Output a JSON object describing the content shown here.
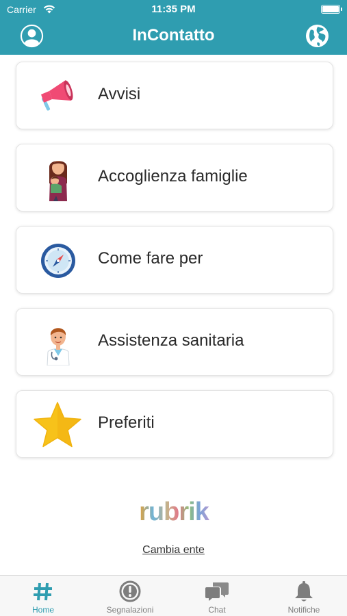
{
  "status_bar": {
    "carrier": "Carrier",
    "time": "11:35 PM"
  },
  "nav": {
    "title": "InContatto"
  },
  "menu": [
    {
      "label": "Avvisi",
      "icon": "megaphone-icon"
    },
    {
      "label": "Accoglienza famiglie",
      "icon": "mother-child-icon"
    },
    {
      "label": "Come fare per",
      "icon": "compass-icon"
    },
    {
      "label": "Assistenza sanitaria",
      "icon": "doctor-icon"
    },
    {
      "label": "Preferiti",
      "icon": "star-icon"
    }
  ],
  "footer": {
    "logo_text": "rubrik",
    "cambia_ente": "Cambia ente"
  },
  "tabs": [
    {
      "label": "Home",
      "icon": "hashtag-icon",
      "active": true
    },
    {
      "label": "Segnalazioni",
      "icon": "alert-circle-icon",
      "active": false
    },
    {
      "label": "Chat",
      "icon": "chat-bubble-icon",
      "active": false
    },
    {
      "label": "Notifiche",
      "icon": "bell-icon",
      "active": false
    }
  ],
  "colors": {
    "primary": "#2f9db0",
    "tab_inactive": "#7d7d7d",
    "star": "#f7c21a"
  }
}
